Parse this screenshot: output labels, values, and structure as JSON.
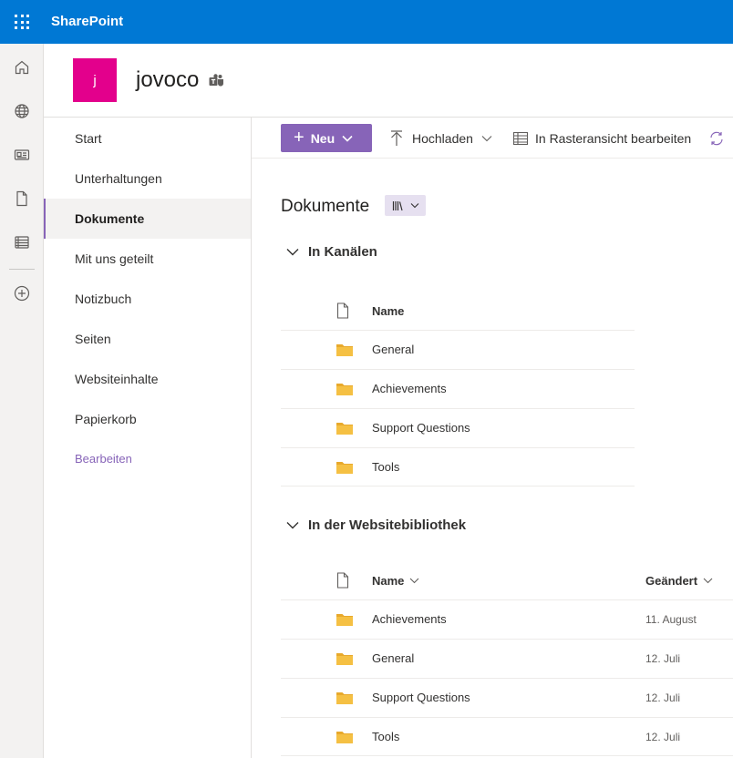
{
  "app": {
    "name": "SharePoint"
  },
  "site": {
    "logo_letter": "j",
    "name": "jovoco"
  },
  "colors": {
    "suite_bar": "#0078d4",
    "accent": "#8764b8",
    "site_logo": "#e3008c",
    "folder": "#f5c043"
  },
  "rail": [
    {
      "icon": "home-icon"
    },
    {
      "icon": "globe-icon"
    },
    {
      "icon": "news-icon"
    },
    {
      "icon": "document-icon"
    },
    {
      "icon": "lists-icon"
    },
    {
      "icon": "add-circle-icon"
    }
  ],
  "nav": {
    "items": [
      {
        "label": "Start"
      },
      {
        "label": "Unterhaltungen"
      },
      {
        "label": "Dokumente",
        "active": true
      },
      {
        "label": "Mit uns geteilt"
      },
      {
        "label": "Notizbuch"
      },
      {
        "label": "Seiten"
      },
      {
        "label": "Websiteinhalte"
      },
      {
        "label": "Papierkorb"
      }
    ],
    "edit_label": "Bearbeiten"
  },
  "commandbar": {
    "new_label": "Neu",
    "upload_label": "Hochladen",
    "grid_label": "In Rasteransicht bearbeiten"
  },
  "library": {
    "title": "Dokumente",
    "sections": [
      {
        "title": "In Kanälen",
        "columns": {
          "name": "Name"
        },
        "rows": [
          {
            "name": "General"
          },
          {
            "name": "Achievements"
          },
          {
            "name": "Support Questions"
          },
          {
            "name": "Tools"
          }
        ]
      },
      {
        "title": "In der Websitebibliothek",
        "columns": {
          "name": "Name",
          "modified": "Geändert"
        },
        "rows": [
          {
            "name": "Achievements",
            "modified": "11. August"
          },
          {
            "name": "General",
            "modified": "12. Juli"
          },
          {
            "name": "Support Questions",
            "modified": "12. Juli"
          },
          {
            "name": "Tools",
            "modified": "12. Juli"
          }
        ]
      }
    ]
  }
}
